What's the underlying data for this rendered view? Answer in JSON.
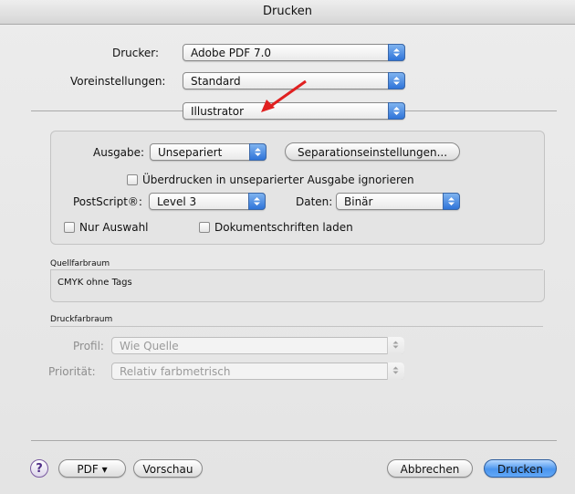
{
  "window": {
    "title": "Drucken"
  },
  "printer": {
    "label": "Drucker:",
    "value": "Adobe PDF 7.0"
  },
  "presets": {
    "label": "Voreinstellungen:",
    "value": "Standard"
  },
  "panel": {
    "value": "Illustrator"
  },
  "output": {
    "label": "Ausgabe:",
    "value": "Unsepariert",
    "separation_button": "Separationseinstellungen...",
    "overprint_checkbox": "Überdrucken in unseparierter Ausgabe ignorieren",
    "postscript_label": "PostScript®:",
    "postscript_value": "Level 3",
    "data_label": "Daten:",
    "data_value": "Binär",
    "selection_checkbox": "Nur Auswahl",
    "fonts_checkbox": "Dokumentschriften laden"
  },
  "source_space": {
    "heading": "Quellfarbraum",
    "value": "CMYK ohne Tags"
  },
  "print_space": {
    "heading": "Druckfarbraum",
    "profile_label": "Profil:",
    "profile_value": "Wie Quelle",
    "priority_label": "Priorität:",
    "priority_value": "Relativ farbmetrisch"
  },
  "footer": {
    "help": "?",
    "pdf_button": "PDF ▾",
    "preview_button": "Vorschau",
    "cancel_button": "Abbrechen",
    "print_button": "Drucken"
  },
  "colors": {
    "accent": "#4a95ee",
    "annotation_arrow": "#e02020"
  }
}
